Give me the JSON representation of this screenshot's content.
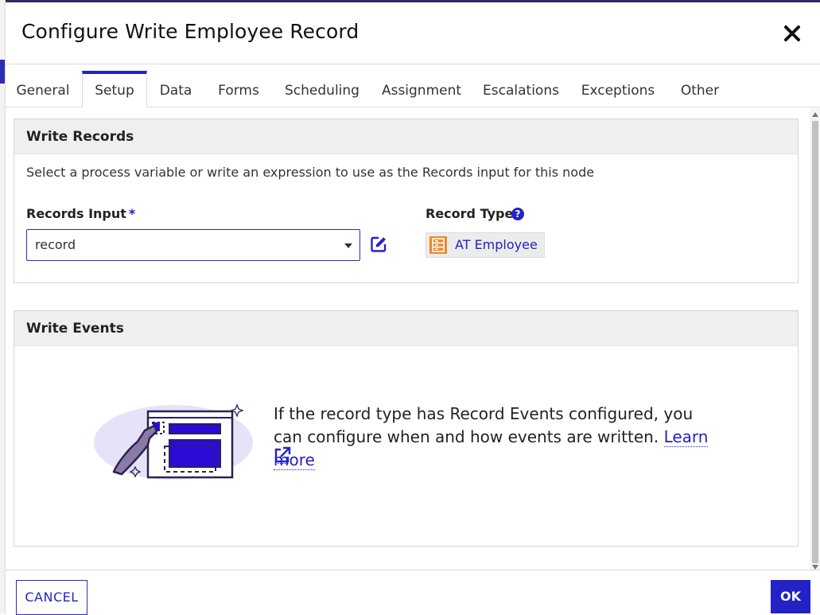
{
  "dialog": {
    "title": "Configure Write Employee Record"
  },
  "tabs": [
    {
      "label": "General"
    },
    {
      "label": "Setup",
      "active": true
    },
    {
      "label": "Data"
    },
    {
      "label": "Forms"
    },
    {
      "label": "Scheduling"
    },
    {
      "label": "Assignment"
    },
    {
      "label": "Escalations"
    },
    {
      "label": "Exceptions"
    },
    {
      "label": "Other"
    }
  ],
  "write_records": {
    "heading": "Write Records",
    "description": "Select a process variable or write an expression to use as the Records input for this node",
    "records_input_label": "Records Input",
    "required_mark": "*",
    "records_input_value": "record",
    "record_type_label": "Record Type",
    "help_glyph": "?",
    "record_type_value": "AT Employee"
  },
  "write_events": {
    "heading": "Write Events",
    "message": "If the record type has Record Events configured, you can configure when and how events are written.",
    "learn_more": "Learn more"
  },
  "footer": {
    "cancel_label": "CANCEL",
    "ok_label": "OK"
  },
  "colors": {
    "accent": "#2322c5",
    "record_icon": "#e8892b",
    "illustration_purple": "#2c0bd6"
  },
  "icons": [
    "close-icon",
    "caret-down-icon",
    "edit-icon",
    "help-icon",
    "record-type-icon",
    "external-link-icon"
  ]
}
